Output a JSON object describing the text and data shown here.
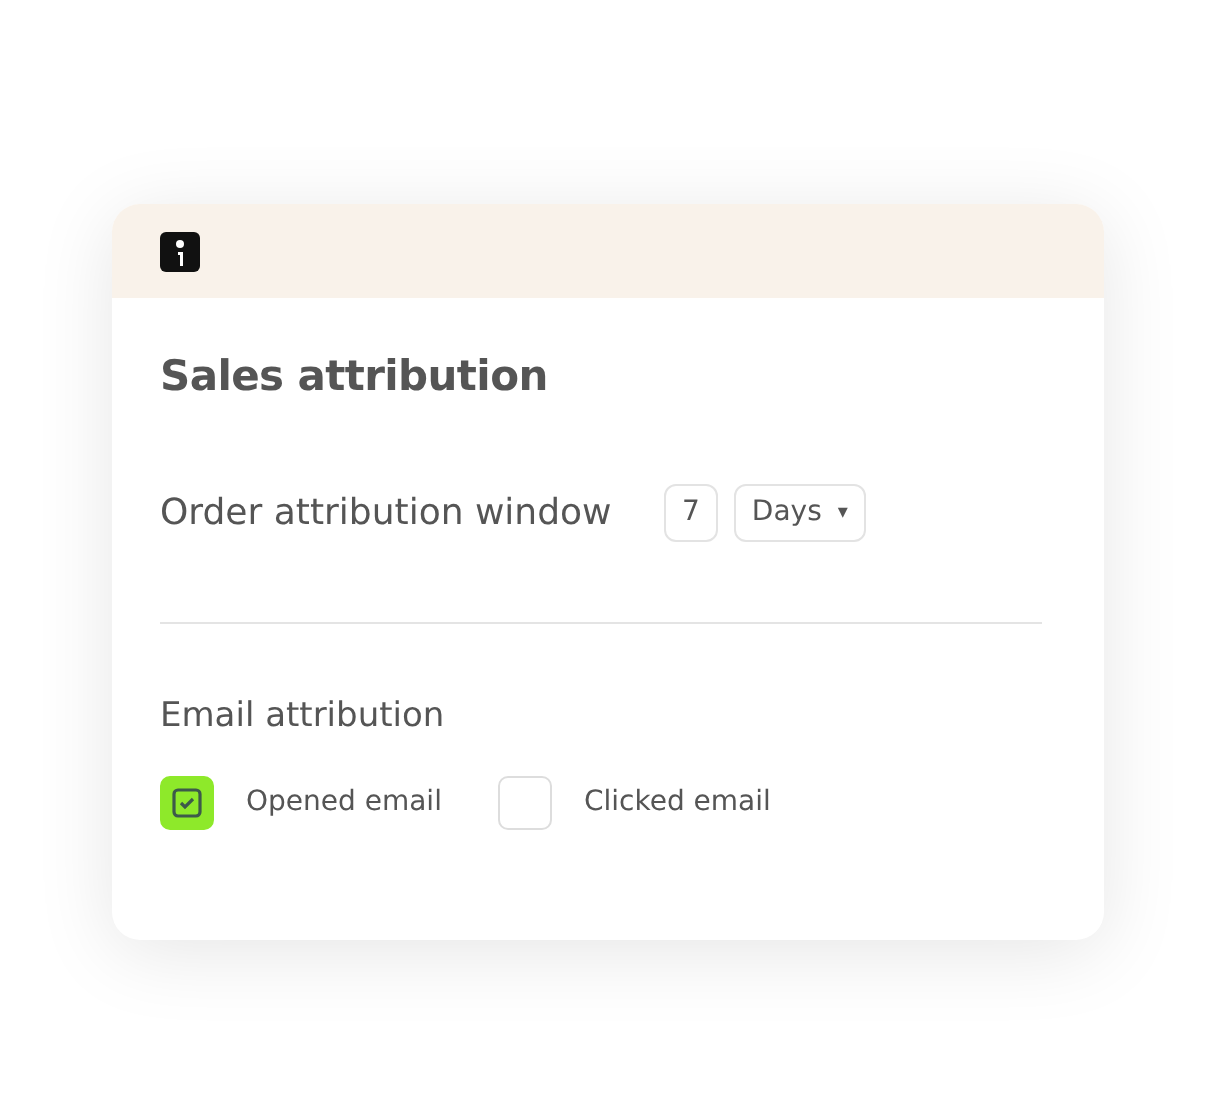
{
  "title": "Sales attribution",
  "order_window": {
    "label": "Order attribution window",
    "value": "7",
    "unit": "Days",
    "caret": "▾"
  },
  "email_attribution": {
    "heading": "Email attribution",
    "options": [
      {
        "label": "Opened email",
        "checked": true
      },
      {
        "label": "Clicked email",
        "checked": false
      }
    ]
  }
}
